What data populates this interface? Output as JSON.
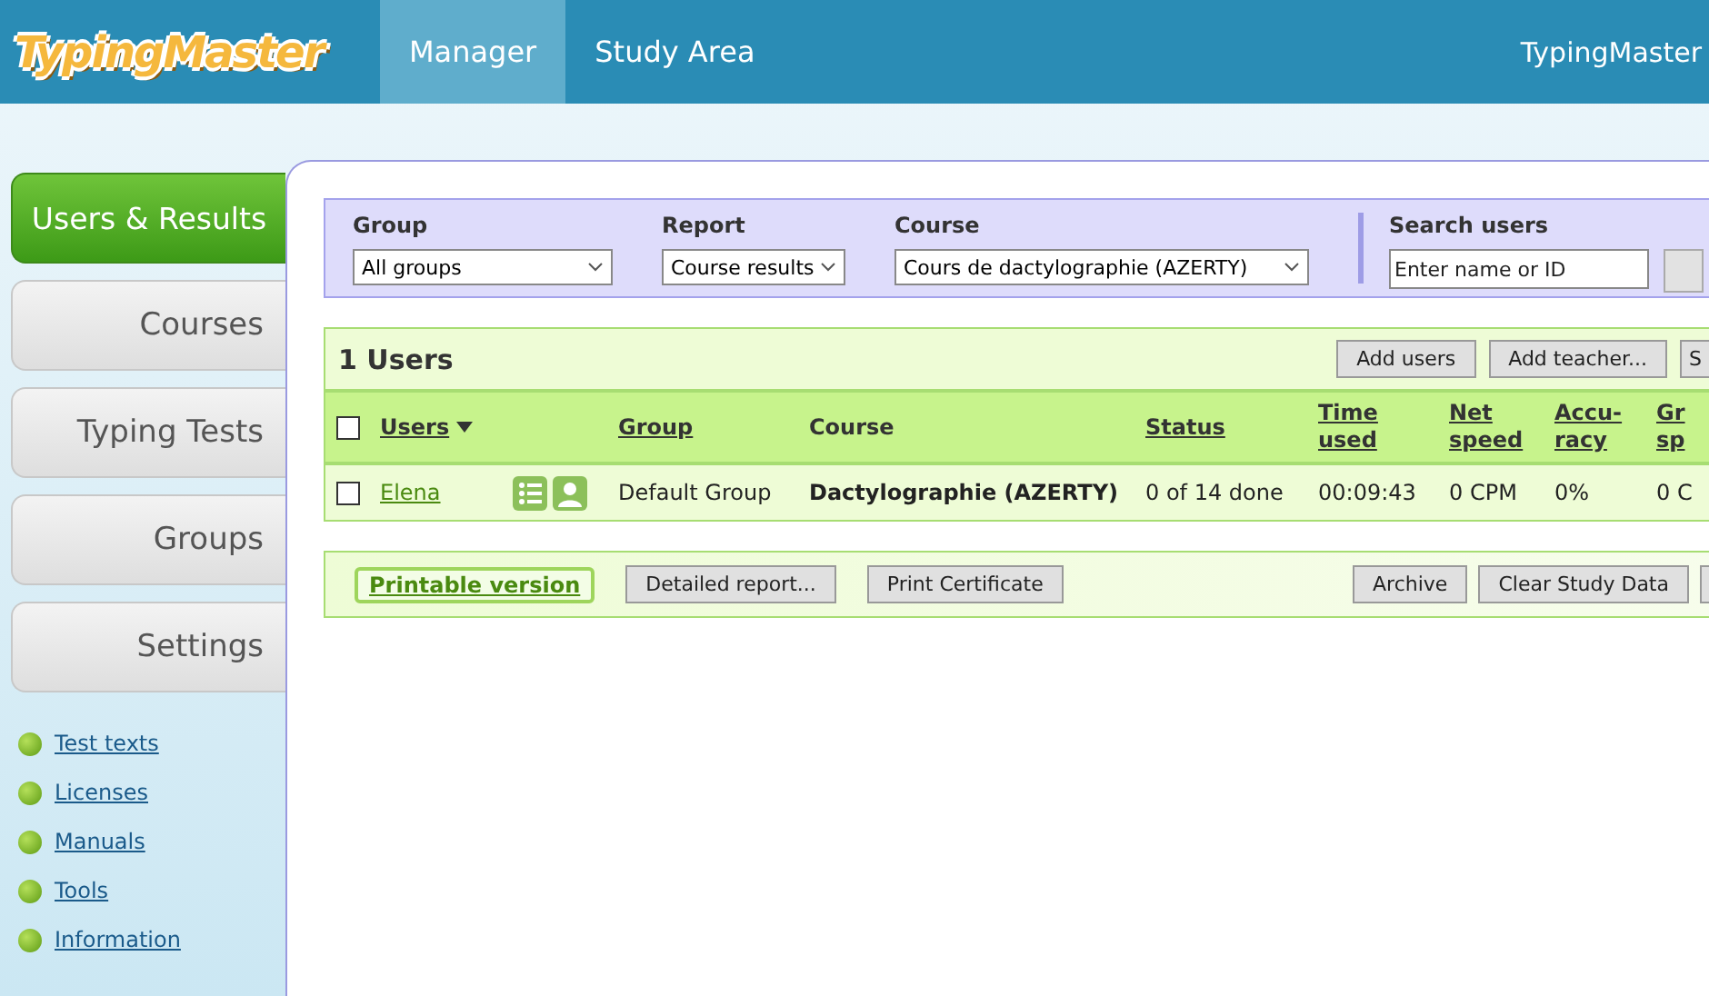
{
  "header": {
    "logo": "TypingMaster",
    "nav": [
      {
        "label": "Manager",
        "selected": true
      },
      {
        "label": "Study Area",
        "selected": false
      }
    ],
    "account": "TypingMaster"
  },
  "sidebar": {
    "tabs": [
      {
        "label": "Users & Results",
        "selected": true
      },
      {
        "label": "Courses",
        "selected": false
      },
      {
        "label": "Typing Tests",
        "selected": false
      },
      {
        "label": "Groups",
        "selected": false
      },
      {
        "label": "Settings",
        "selected": false
      }
    ],
    "links": [
      "Test texts",
      "Licenses",
      "Manuals",
      "Tools",
      "Information"
    ]
  },
  "filters": {
    "group": {
      "label": "Group",
      "value": "All groups"
    },
    "report": {
      "label": "Report",
      "value": "Course results"
    },
    "course": {
      "label": "Course",
      "value": "Cours de dactylographie (AZERTY)"
    },
    "search": {
      "label": "Search users",
      "placeholder": "Enter name or ID"
    }
  },
  "users": {
    "title": "1 Users",
    "all_checked": false,
    "buttons": [
      "Add users",
      "Add teacher...",
      "S"
    ],
    "columns": [
      {
        "lines": [
          "Users"
        ],
        "sortable": true,
        "sorted": true
      },
      {
        "lines": [
          "Group"
        ],
        "sortable": true,
        "sorted": false
      },
      {
        "lines": [
          "Course"
        ],
        "sortable": false,
        "sorted": false
      },
      {
        "lines": [
          "Status"
        ],
        "sortable": true,
        "sorted": false
      },
      {
        "lines": [
          "Time",
          "used"
        ],
        "sortable": true,
        "sorted": false
      },
      {
        "lines": [
          "Net",
          "speed"
        ],
        "sortable": true,
        "sorted": false
      },
      {
        "lines": [
          "Accu-",
          "racy"
        ],
        "sortable": true,
        "sorted": false
      },
      {
        "lines": [
          "Gr",
          "sp"
        ],
        "sortable": true,
        "sorted": false
      }
    ],
    "rows": [
      {
        "checked": false,
        "name": "Elena",
        "group": "Default Group",
        "course": "Dactylographie (AZERTY)",
        "status": "0 of 14 done",
        "time": "00:09:43",
        "net_speed": "0 CPM",
        "accuracy": "0%",
        "column_9": "0 C"
      }
    ]
  },
  "actions": {
    "printable": "Printable version",
    "left": [
      "Detailed report...",
      "Print Certificate"
    ],
    "right": [
      "Archive",
      "Clear Study Data"
    ]
  }
}
